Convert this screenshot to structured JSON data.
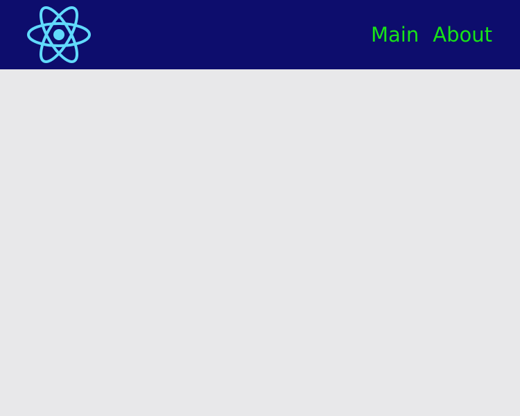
{
  "theme": {
    "header_background": "#0d0d6d",
    "page_background": "#e8e8ea",
    "nav_link_color": "#18e318",
    "logo_color": "#61dafb"
  },
  "header": {
    "logo_icon": "react-atom-icon",
    "nav": {
      "items": [
        {
          "label": "Main"
        },
        {
          "label": "About"
        }
      ]
    }
  }
}
